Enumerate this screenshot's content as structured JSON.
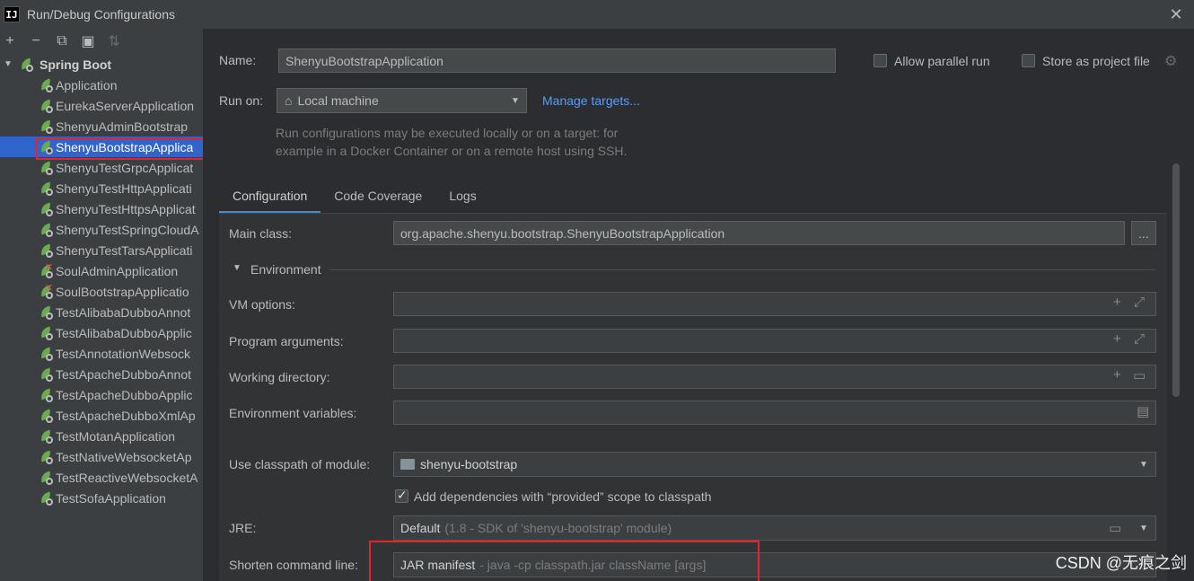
{
  "window": {
    "title": "Run/Debug Configurations",
    "app_icon": "IJ",
    "close_glyph": "✕"
  },
  "toolbar": {
    "add": "+",
    "remove": "−",
    "copy": "⧉",
    "folder": "▣",
    "sort": "⇅"
  },
  "tree": {
    "group_label": "Spring Boot",
    "items": [
      "Application",
      "EurekaServerApplication",
      "ShenyuAdminBootstrap",
      "ShenyuBootstrapApplica",
      "ShenyuTestGrpcApplicat",
      "ShenyuTestHttpApplicati",
      "ShenyuTestHttpsApplicat",
      "ShenyuTestSpringCloudA",
      "ShenyuTestTarsApplicati",
      "SoulAdminApplication",
      "SoulBootstrapApplicatio",
      "TestAlibabaDubboAnnot",
      "TestAlibabaDubboApplic",
      "TestAnnotationWebsock",
      "TestApacheDubboAnnot",
      "TestApacheDubboApplic",
      "TestApacheDubboXmlAp",
      "TestMotanApplication",
      "TestNativeWebsocketAp",
      "TestReactiveWebsocketA",
      "TestSofaApplication"
    ]
  },
  "form": {
    "name_label": "Name:",
    "name_value": "ShenyuBootstrapApplication",
    "allow_parallel_label": "Allow parallel run",
    "store_project_label": "Store as project file",
    "run_on_label": "Run on:",
    "run_on_value": "Local machine",
    "manage_targets": "Manage targets...",
    "hint_line1": "Run configurations may be executed locally or on a target: for",
    "hint_line2": "example in a Docker Container or on a remote host using SSH.",
    "tabs": [
      "Configuration",
      "Code Coverage",
      "Logs"
    ],
    "main_class_label": "Main class:",
    "main_class_value": "org.apache.shenyu.bootstrap.ShenyuBootstrapApplication",
    "browse_button": "...",
    "environment_section": "Environment",
    "vm_options_label": "VM options:",
    "program_args_label": "Program arguments:",
    "working_dir_label": "Working directory:",
    "env_vars_label": "Environment variables:",
    "classpath_label": "Use classpath of module:",
    "classpath_value": "shenyu-bootstrap",
    "add_deps_label": "Add dependencies with “provided” scope to classpath",
    "jre_label": "JRE:",
    "jre_value": "Default",
    "jre_hint": "(1.8 - SDK of 'shenyu-bootstrap' module)",
    "shorten_label": "Shorten command line:",
    "shorten_value": "JAR manifest",
    "shorten_hint": "- java -cp classpath.jar className [args]"
  },
  "watermark": "CSDN @无痕之剑"
}
